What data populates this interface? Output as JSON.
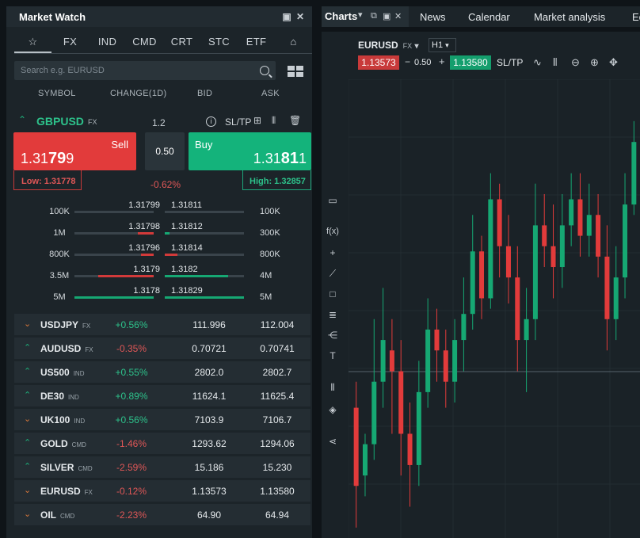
{
  "market_watch": {
    "title": "Market Watch",
    "tabs": [
      "☆",
      "FX",
      "IND",
      "CMD",
      "CRT",
      "STC",
      "ETF",
      "⌂"
    ],
    "search_placeholder": "Search e.g. EURUSD",
    "columns": {
      "symbol": "SYMBOL",
      "change": "CHANGE(1D)",
      "bid": "BID",
      "ask": "ASK"
    },
    "expanded": {
      "symbol": "GBPUSD",
      "tag": "FX",
      "spread_value": "1.2",
      "sltp": "SL/TP",
      "sell_label": "Sell",
      "sell_price_pre": "1.31",
      "sell_price_big": "79",
      "sell_price_post": "9",
      "buy_label": "Buy",
      "buy_price_pre": "1.31",
      "buy_price_big": "81",
      "buy_price_post": "1",
      "volume": "0.50",
      "low": "Low: 1.31778",
      "high": "High: 1.32857",
      "change": "-0.62%"
    },
    "depth": [
      {
        "vol_left": "100K",
        "bid": "1.31799",
        "ask": "1.31811",
        "vol_right": "100K",
        "bid_fill": 0.0,
        "ask_fill": 0.0
      },
      {
        "vol_left": "1M",
        "bid": "1.31798",
        "ask": "1.31812",
        "vol_right": "300K",
        "bid_fill": 0.2,
        "ask_fill": 0.06
      },
      {
        "vol_left": "800K",
        "bid": "1.31796",
        "ask": "1.31814",
        "vol_right": "800K",
        "bid_fill": 0.16,
        "ask_fill": 0.16
      },
      {
        "vol_left": "3.5M",
        "bid": "1.3179",
        "ask": "1.3182",
        "vol_right": "4M",
        "bid_fill": 0.7,
        "ask_fill": 0.8
      },
      {
        "vol_left": "5M",
        "bid": "1.3178",
        "ask": "1.31829",
        "vol_right": "5M",
        "bid_fill": 1.0,
        "ask_fill": 1.0
      }
    ],
    "instruments": [
      {
        "symbol": "USDJPY",
        "tag": "FX",
        "dir": "down",
        "change": "+0.56%",
        "pos": true,
        "bid": "111.996",
        "ask": "112.004"
      },
      {
        "symbol": "AUDUSD",
        "tag": "FX",
        "dir": "up",
        "change": "-0.35%",
        "pos": false,
        "bid": "0.70721",
        "ask": "0.70741"
      },
      {
        "symbol": "US500",
        "tag": "IND",
        "dir": "up",
        "change": "+0.55%",
        "pos": true,
        "bid": "2802.0",
        "ask": "2802.7"
      },
      {
        "symbol": "DE30",
        "tag": "IND",
        "dir": "up",
        "change": "+0.89%",
        "pos": true,
        "bid": "11624.1",
        "ask": "11625.4"
      },
      {
        "symbol": "UK100",
        "tag": "IND",
        "dir": "down",
        "change": "+0.56%",
        "pos": true,
        "bid": "7103.9",
        "ask": "7106.7"
      },
      {
        "symbol": "GOLD",
        "tag": "CMD",
        "dir": "up",
        "change": "-1.46%",
        "pos": false,
        "bid": "1293.62",
        "ask": "1294.06"
      },
      {
        "symbol": "SILVER",
        "tag": "CMD",
        "dir": "up",
        "change": "-2.59%",
        "pos": false,
        "bid": "15.186",
        "ask": "15.230"
      },
      {
        "symbol": "EURUSD",
        "tag": "FX",
        "dir": "down",
        "change": "-0.12%",
        "pos": false,
        "bid": "1.13573",
        "ask": "1.13580"
      },
      {
        "symbol": "OIL",
        "tag": "CMD",
        "dir": "down",
        "change": "-2.23%",
        "pos": false,
        "bid": "64.90",
        "ask": "64.94"
      }
    ]
  },
  "charts": {
    "tab_title": "Charts",
    "top_tabs": [
      "News",
      "Calendar",
      "Market analysis",
      "Ec"
    ],
    "symbol": "EURUSD",
    "tag": "FX",
    "timeframe": "H1",
    "sell_price": "1.13573",
    "spread": "0.50",
    "buy_price": "1.13580",
    "sltp": "SL/TP"
  },
  "colors": {
    "up": "#16a873",
    "down": "#e23b3b",
    "panel": "#1c2429"
  },
  "chart_data": {
    "type": "candlestick",
    "candles": [
      [
        0.55,
        0.4,
        0.6,
        0.32
      ],
      [
        0.42,
        0.48,
        0.5,
        0.38
      ],
      [
        0.48,
        0.6,
        0.72,
        0.45
      ],
      [
        0.6,
        0.68,
        0.78,
        0.55
      ],
      [
        0.66,
        0.62,
        0.72,
        0.5
      ],
      [
        0.62,
        0.5,
        0.68,
        0.42
      ],
      [
        0.5,
        0.44,
        0.56,
        0.36
      ],
      [
        0.44,
        0.58,
        0.64,
        0.4
      ],
      [
        0.58,
        0.7,
        0.76,
        0.55
      ],
      [
        0.7,
        0.66,
        0.74,
        0.6
      ],
      [
        0.66,
        0.6,
        0.7,
        0.55
      ],
      [
        0.6,
        0.68,
        0.72,
        0.56
      ],
      [
        0.68,
        0.73,
        0.8,
        0.62
      ],
      [
        0.73,
        0.85,
        0.92,
        0.7
      ],
      [
        0.85,
        0.76,
        0.88,
        0.72
      ],
      [
        0.76,
        0.95,
        1.0,
        0.74
      ],
      [
        0.95,
        0.86,
        0.98,
        0.8
      ],
      [
        0.86,
        0.8,
        0.92,
        0.75
      ],
      [
        0.8,
        0.68,
        0.86,
        0.62
      ],
      [
        0.68,
        0.72,
        0.78,
        0.58
      ],
      [
        0.72,
        0.9,
        0.98,
        0.68
      ],
      [
        0.9,
        0.86,
        0.96,
        0.82
      ],
      [
        0.86,
        0.82,
        0.94,
        0.76
      ],
      [
        0.82,
        0.9,
        0.96,
        0.78
      ],
      [
        0.9,
        0.95,
        1.0,
        0.86
      ],
      [
        0.95,
        0.88,
        1.0,
        0.84
      ],
      [
        0.88,
        0.92,
        0.98,
        0.84
      ],
      [
        0.92,
        0.84,
        0.96,
        0.8
      ],
      [
        0.84,
        0.72,
        0.9,
        0.66
      ],
      [
        0.72,
        0.8,
        0.86,
        0.68
      ],
      [
        0.8,
        0.94,
        1.0,
        0.76
      ],
      [
        0.94,
        1.06,
        1.1,
        0.92
      ]
    ],
    "ylim": [
      0.3,
      1.15
    ],
    "grid": true
  }
}
